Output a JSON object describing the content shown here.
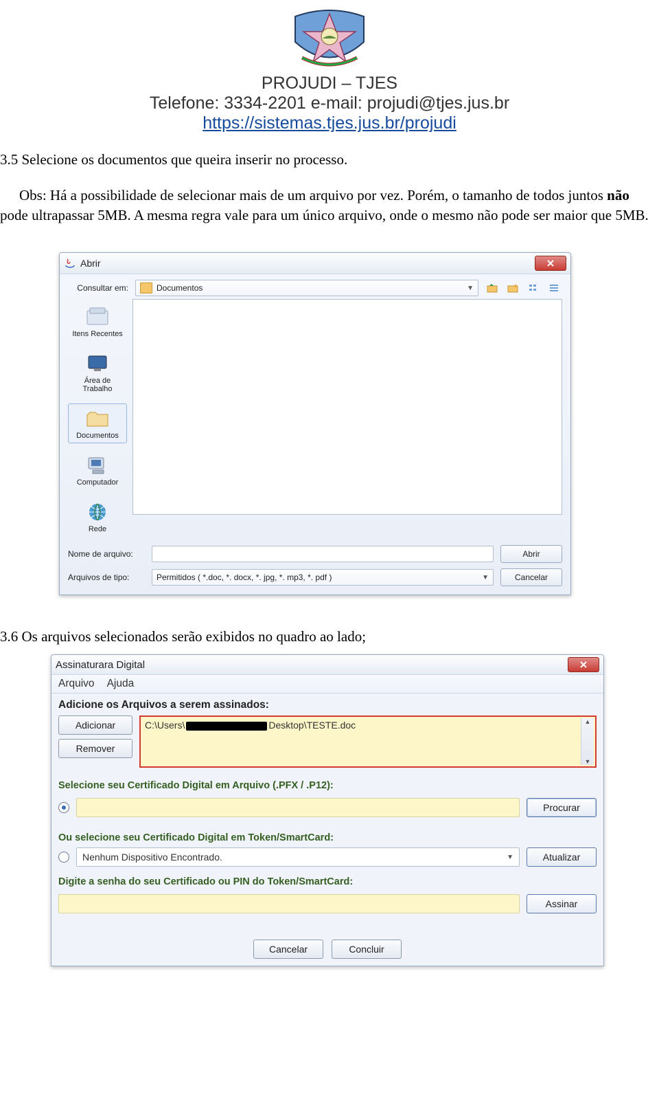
{
  "header": {
    "title": "PROJUDI – TJES",
    "contact": "Telefone: 3334-2201 e-mail: projudi@tjes.jus.br",
    "link": "https://sistemas.tjes.jus.br/projudi"
  },
  "text": {
    "p1": "3.5 Selecione os documentos que queira inserir no processo.",
    "p2a": "Obs: Há a possibilidade de selecionar mais de um arquivo por vez. Porém, o tamanho de todos juntos ",
    "p2bold": "não",
    "p2b": " pode ultrapassar 5MB. A mesma regra vale para um único arquivo, onde o mesmo não pode ser maior que 5MB.",
    "p3": "3.6 Os arquivos selecionados serão exibidos no quadro ao lado;"
  },
  "open_dialog": {
    "title": "Abrir",
    "lookin_label": "Consultar em:",
    "lookin_value": "Documentos",
    "places": {
      "recent": "Itens Recentes",
      "desktop": "Área de Trabalho",
      "documents": "Documentos",
      "computer": "Computador",
      "network": "Rede"
    },
    "filename_label": "Nome de arquivo:",
    "filename_value": "",
    "filetype_label": "Arquivos de tipo:",
    "filetype_value": "Permitidos ( *.doc, *. docx, *. jpg, *. mp3, *. pdf )",
    "open_btn": "Abrir",
    "cancel_btn": "Cancelar"
  },
  "sign_dialog": {
    "title": "Assinaturara Digital",
    "menu": {
      "arquivo": "Arquivo",
      "ajuda": "Ajuda"
    },
    "section_add": "Adicione os Arquivos a serem assinados:",
    "add_btn": "Adicionar",
    "remove_btn": "Remover",
    "file_prefix": "C:\\Users\\",
    "file_suffix": "Desktop\\TESTE.doc",
    "cert_file_label": "Selecione seu Certificado Digital em Arquivo (.PFX / .P12):",
    "browse_btn": "Procurar",
    "cert_token_label": "Ou selecione seu Certificado Digital em Token/SmartCard:",
    "token_value": "Nenhum Dispositivo Encontrado.",
    "refresh_btn": "Atualizar",
    "pin_label": "Digite a senha do seu Certificado ou PIN do Token/SmartCard:",
    "sign_btn": "Assinar",
    "cancel_btn": "Cancelar",
    "finish_btn": "Concluir"
  }
}
